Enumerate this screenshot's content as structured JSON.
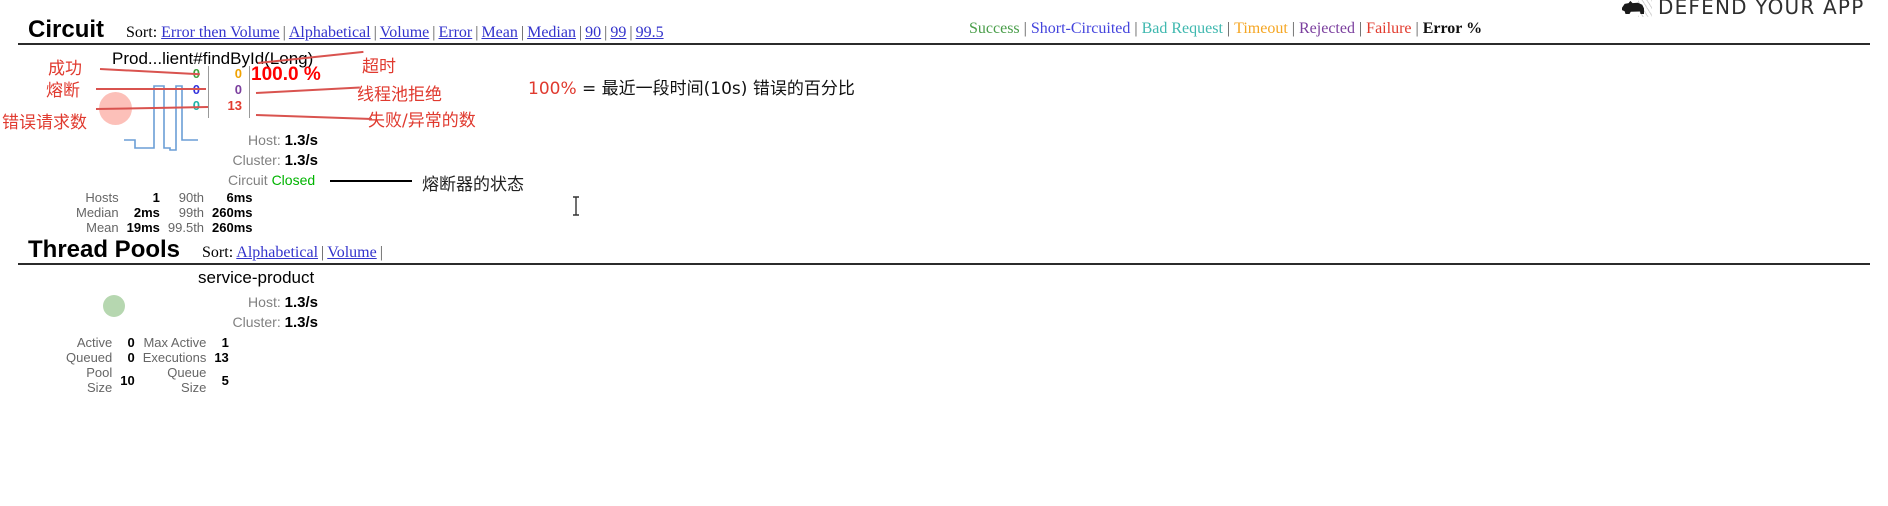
{
  "banner": {
    "text": "DEFEND YOUR APP",
    "logo_icon": "porcupine-logo-icon"
  },
  "circuit_section": {
    "title": "Circuit",
    "sort_label": "Sort:",
    "sort_links": [
      "Error then Volume",
      "Alphabetical",
      "Volume",
      "Error",
      "Mean",
      "Median",
      "90",
      "99",
      "99.5"
    ],
    "legend": [
      {
        "label": "Success",
        "color": "#4a9e4a"
      },
      {
        "label": "Short-Circuited",
        "color": "#4444dd"
      },
      {
        "label": "Bad Request",
        "color": "#3fb8af"
      },
      {
        "label": "Timeout",
        "color": "#f5a623"
      },
      {
        "label": "Rejected",
        "color": "#7b3f9e"
      },
      {
        "label": "Failure",
        "color": "#e23b2e"
      },
      {
        "label": "Error %",
        "color": "#111111"
      }
    ]
  },
  "circuit": {
    "name": "Prod...lient#findById(Long)",
    "counts_left": [
      {
        "value": "0",
        "color": "#3fa13f",
        "meaning": "success"
      },
      {
        "value": "0",
        "color": "#3333dd",
        "meaning": "short-circuited"
      },
      {
        "value": "0",
        "color": "#1fb3a8",
        "meaning": "bad-request"
      }
    ],
    "counts_right": [
      {
        "value": "0",
        "color": "#f0a202",
        "meaning": "timeout"
      },
      {
        "value": "0",
        "color": "#7b3f9e",
        "meaning": "rejected"
      },
      {
        "value": "13",
        "color": "#e23b2e",
        "meaning": "failure"
      }
    ],
    "error_percent": "100.0 %",
    "host_label": "Host:",
    "host_rate": "1.3/s",
    "cluster_label": "Cluster:",
    "cluster_rate": "1.3/s",
    "circuit_label": "Circuit",
    "circuit_state": "Closed",
    "stats": [
      {
        "l1": "Hosts",
        "v1": "1",
        "l2": "90th",
        "v2": "6ms"
      },
      {
        "l1": "Median",
        "v1": "2ms",
        "l2": "99th",
        "v2": "260ms"
      },
      {
        "l1": "Mean",
        "v1": "19ms",
        "l2": "99.5th",
        "v2": "260ms"
      }
    ]
  },
  "threadpool_section": {
    "title": "Thread Pools",
    "sort_label": "Sort:",
    "sort_links": [
      "Alphabetical",
      "Volume"
    ]
  },
  "threadpool": {
    "name": "service-product",
    "host_label": "Host:",
    "host_rate": "1.3/s",
    "cluster_label": "Cluster:",
    "cluster_rate": "1.3/s",
    "stats": [
      {
        "l1": "Active",
        "v1": "0",
        "l2": "Max Active",
        "v2": "1"
      },
      {
        "l1": "Queued",
        "v1": "0",
        "l2": "Executions",
        "v2": "13"
      },
      {
        "l1": "Pool Size",
        "v1": "10",
        "l2": "Queue Size",
        "v2": "5"
      }
    ]
  },
  "annotations": {
    "success": "成功",
    "short_circuit": "熔断",
    "error_requests": "错误请求数",
    "timeout": "超时",
    "thread_pool_rejected": "线程池拒绝",
    "failure_exception": "失败/异常的数",
    "circuit_state": "熔断器的状态",
    "formula_pct": "100%",
    "formula_eq": "=",
    "formula_text": "最近一段时间(10s) 错误的百分比"
  }
}
